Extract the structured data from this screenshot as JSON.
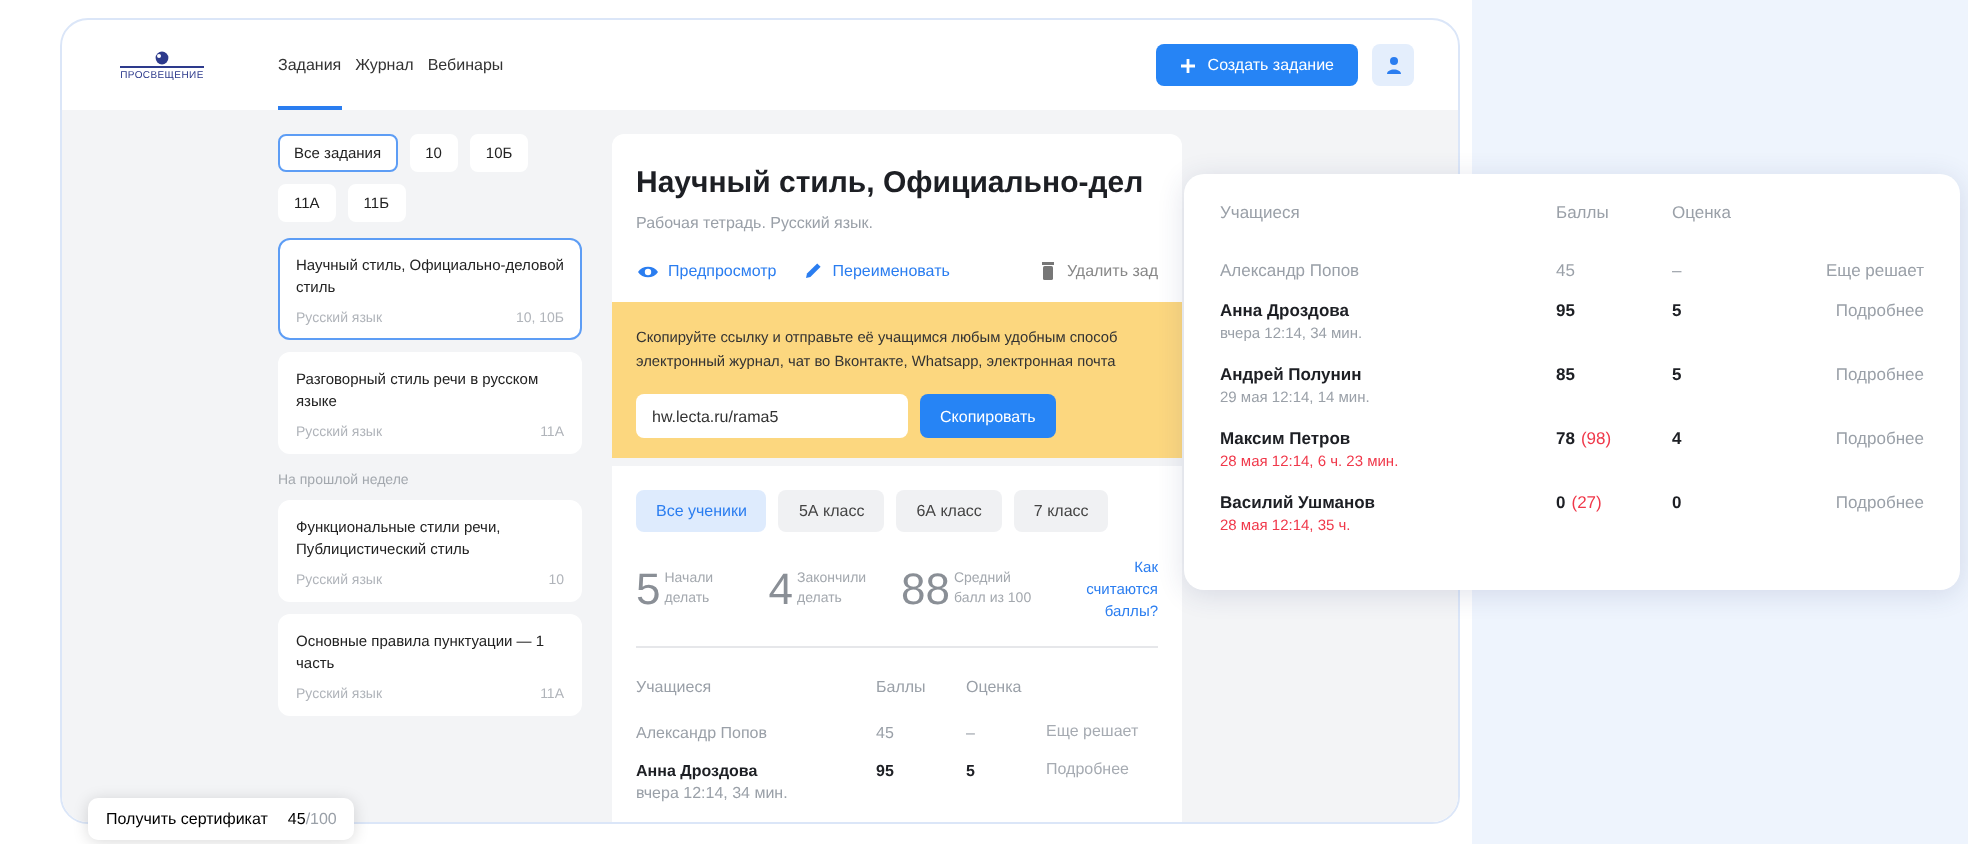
{
  "logo": {
    "text": "ПРОСВЕЩЕНИЕ"
  },
  "nav_tabs": [
    {
      "label": "Задания",
      "selected": true
    },
    {
      "label": "Журнал",
      "selected": false
    },
    {
      "label": "Вебинары",
      "selected": false
    }
  ],
  "create_button": {
    "label": "Создать задание"
  },
  "filters": [
    {
      "label": "Все задания",
      "selected": true
    },
    {
      "label": "10",
      "selected": false
    },
    {
      "label": "10Б",
      "selected": false
    },
    {
      "label": "11А",
      "selected": false
    },
    {
      "label": "11Б",
      "selected": false
    }
  ],
  "tasks": [
    {
      "title": "Научный стиль, Официально-деловой стиль",
      "subject": "Русский язык",
      "classes": "10, 10Б",
      "selected": true
    },
    {
      "title": "Разговорный стиль речи в русском языке",
      "subject": "Русский язык",
      "classes": "11А",
      "selected": false
    }
  ],
  "earlier": {
    "heading": "На прошлой неделе",
    "tasks": [
      {
        "title": "Функциональные стили речи, Публицистический стиль",
        "subject": "Русский язык",
        "classes": "10",
        "selected": false
      },
      {
        "title": "Основные правила пунктуации — 1 часть",
        "subject": "Русский язык",
        "classes": "11А",
        "selected": false
      }
    ]
  },
  "assignment": {
    "title": "Научный стиль, Официально-дел",
    "subtitle": "Рабочая тетрадь. Русский язык.",
    "actions": [
      {
        "kind": "preview",
        "label": "Предпросмотр"
      },
      {
        "kind": "rename",
        "label": "Переименовать"
      },
      {
        "kind": "delete",
        "label": "Удалить зад"
      }
    ],
    "share": {
      "lines": [
        "Скопируйте ссылку и отправьте её учащимся любым удобным способ",
        "электронный журнал, чат во Вконтакте, Whatsapp, электронная почта"
      ],
      "link": "hw.lecta.ru/rama5",
      "copy_button": "Скопировать"
    },
    "class_filters": [
      {
        "label": "Все ученики",
        "selected": true
      },
      {
        "label": "5А класс",
        "selected": false
      },
      {
        "label": "6А класс",
        "selected": false
      },
      {
        "label": "7 класс",
        "selected": false
      }
    ],
    "stats": [
      {
        "value": "5",
        "label": "Начали делать"
      },
      {
        "value": "4",
        "label": "Закончили делать"
      },
      {
        "value": "88",
        "label": "Средний балл из 100"
      }
    ],
    "help_link": "Как считаются баллы?",
    "table": {
      "columns": [
        "Учащиеся",
        "Баллы",
        "Оценка"
      ],
      "rows": [
        {
          "name": "Александр Попов",
          "score": "45",
          "grade": "–",
          "action": "Еще решает",
          "pending": true
        },
        {
          "name": "Анна Дроздова",
          "time": "вчера 12:14, 34 мин.",
          "score": "95",
          "grade": "5",
          "action": "Подробнее",
          "pending": false,
          "late": false
        }
      ]
    }
  },
  "popup": {
    "columns": [
      "Учащиеся",
      "Баллы",
      "Оценка"
    ],
    "rows": [
      {
        "name": "Александр Попов",
        "score": "45",
        "grade": "–",
        "action": "Еще решает",
        "pending": true
      },
      {
        "name": "Анна Дроздова",
        "time": "вчера 12:14, 34 мин.",
        "score": "95",
        "grade": "5",
        "action": "Подробнее",
        "pending": false,
        "late": false
      },
      {
        "name": "Андрей Полунин",
        "time": "29 мая 12:14, 14 мин.",
        "score": "85",
        "grade": "5",
        "action": "Подробнее",
        "pending": false,
        "late": false
      },
      {
        "name": "Максим Петров",
        "time": "28 мая 12:14, 6 ч. 23 мин.",
        "score": "78",
        "penalty": "(98)",
        "grade": "4",
        "action": "Подробнее",
        "pending": false,
        "late": true
      },
      {
        "name": "Василий Ушманов",
        "time": "28 мая 12:14, 35 ч.",
        "score": "0",
        "penalty": "(27)",
        "grade": "0",
        "action": "Подробнее",
        "pending": false,
        "late": true
      }
    ]
  },
  "certificate": {
    "label": "Получить сертификат",
    "score": "45",
    "total": "/100"
  }
}
